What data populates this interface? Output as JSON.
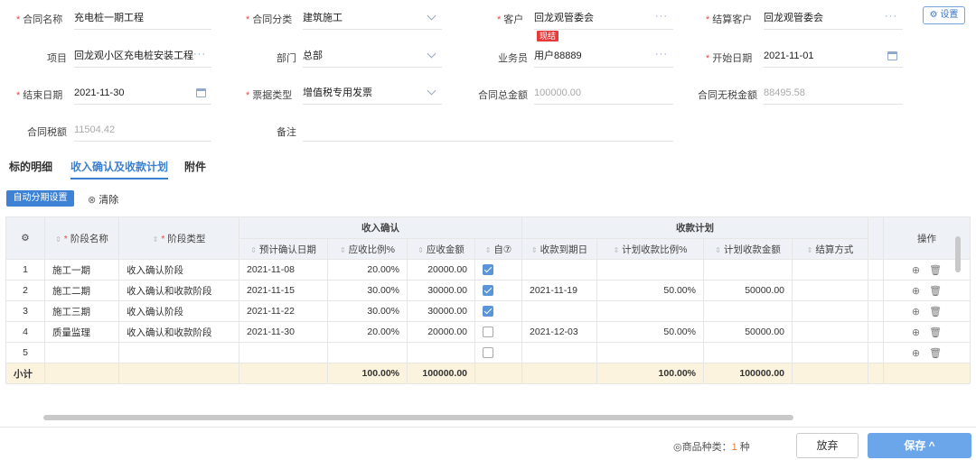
{
  "form": {
    "contract_name_label": "合同名称",
    "contract_name_value": "充电桩一期工程",
    "contract_type_label": "合同分类",
    "contract_type_value": "建筑施工",
    "customer_label": "客户",
    "customer_value": "回龙观管委会",
    "customer_tag": "现结",
    "settle_customer_label": "结算客户",
    "settle_customer_value": "回龙观管委会",
    "settings_label": "设置",
    "project_label": "项目",
    "project_value": "回龙观小区充电桩安装工程",
    "dept_label": "部门",
    "dept_value": "总部",
    "salesman_label": "业务员",
    "salesman_value": "用户88889",
    "start_date_label": "开始日期",
    "start_date_value": "2021-11-01",
    "end_date_label": "结束日期",
    "end_date_value": "2021-11-30",
    "invoice_type_label": "票据类型",
    "invoice_type_value": "增值税专用发票",
    "total_amount_label": "合同总金额",
    "total_amount_value": "100000.00",
    "no_tax_amount_label": "合同无税金额",
    "no_tax_amount_value": "88495.58",
    "tax_amount_label": "合同税额",
    "tax_amount_value": "11504.42",
    "remark_label": "备注",
    "remark_value": ""
  },
  "tabs": [
    "标的明细",
    "收入确认及收款计划",
    "附件"
  ],
  "toolbar": {
    "auto_label": "自动分期设置",
    "clear_label": "清除"
  },
  "table": {
    "group_income": "收入确认",
    "group_plan": "收款计划",
    "col_stage_name": "阶段名称",
    "col_stage_type": "阶段类型",
    "col_confirm_date": "预计确认日期",
    "col_ratio": "应收比例%",
    "col_amount": "应收金额",
    "col_auto": "自",
    "col_due_date": "收款到期日",
    "col_plan_ratio": "计划收款比例%",
    "col_plan_amount": "计划收款金额",
    "col_method": "结算方式",
    "col_ops": "操作",
    "rows": [
      {
        "no": "1",
        "name": "施工一期",
        "type": "收入确认阶段",
        "date": "2021-11-08",
        "ratio": "20.00%",
        "amount": "20000.00",
        "checked": true,
        "due": "",
        "pratio": "",
        "pamount": ""
      },
      {
        "no": "2",
        "name": "施工二期",
        "type": "收入确认和收款阶段",
        "date": "2021-11-15",
        "ratio": "30.00%",
        "amount": "30000.00",
        "checked": true,
        "due": "2021-11-19",
        "pratio": "50.00%",
        "pamount": "50000.00"
      },
      {
        "no": "3",
        "name": "施工三期",
        "type": "收入确认阶段",
        "date": "2021-11-22",
        "ratio": "30.00%",
        "amount": "30000.00",
        "checked": true,
        "due": "",
        "pratio": "",
        "pamount": ""
      },
      {
        "no": "4",
        "name": "质量监理",
        "type": "收入确认和收款阶段",
        "date": "2021-11-30",
        "ratio": "20.00%",
        "amount": "20000.00",
        "checked": false,
        "due": "2021-12-03",
        "pratio": "50.00%",
        "pamount": "50000.00"
      },
      {
        "no": "5",
        "name": "",
        "type": "",
        "date": "",
        "ratio": "",
        "amount": "",
        "checked": false,
        "due": "",
        "pratio": "",
        "pamount": ""
      }
    ],
    "subtotal_label": "小计",
    "subtotal_ratio": "100.00%",
    "subtotal_amount": "100000.00",
    "subtotal_pratio": "100.00%",
    "subtotal_pamount": "100000.00"
  },
  "footer": {
    "kinds_label": "商品种类：",
    "kinds_count": "1",
    "kinds_unit": "种",
    "cancel_label": "放弃",
    "save_label": "保存"
  }
}
